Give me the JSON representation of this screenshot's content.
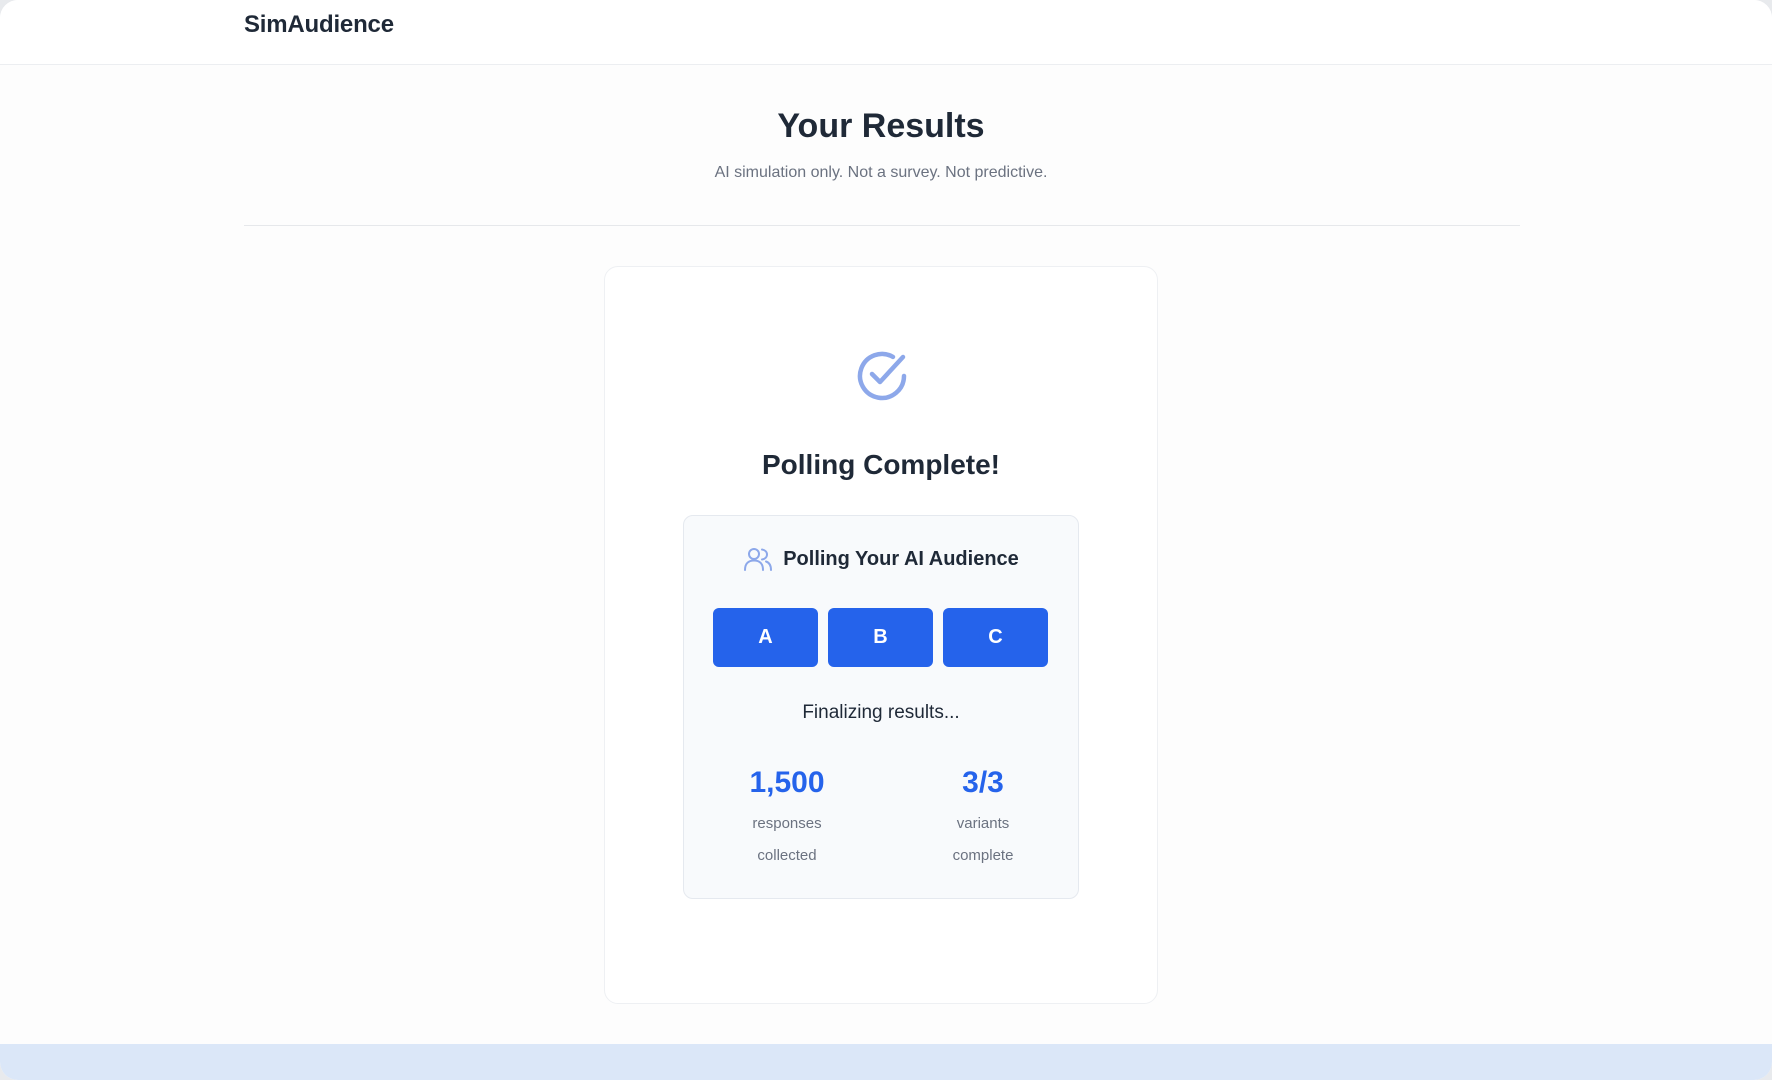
{
  "header": {
    "brand": "SimAudience"
  },
  "page": {
    "title": "Your Results",
    "subtitle": "AI simulation only. Not a survey. Not predictive."
  },
  "result_card": {
    "icon": "check-circle-icon",
    "title": "Polling Complete!",
    "panel": {
      "icon": "users-icon",
      "title": "Polling Your AI Audience",
      "variants": [
        {
          "label": "A"
        },
        {
          "label": "B"
        },
        {
          "label": "C"
        }
      ],
      "status": "Finalizing results...",
      "stats": [
        {
          "value": "1,500",
          "label": "responses\ncollected"
        },
        {
          "value": "3/3",
          "label": "variants\ncomplete"
        }
      ]
    }
  },
  "colors": {
    "accent": "#2563eb",
    "icon_muted": "#8da8ea",
    "text_primary": "#1f2937",
    "text_muted": "#6b7280"
  }
}
